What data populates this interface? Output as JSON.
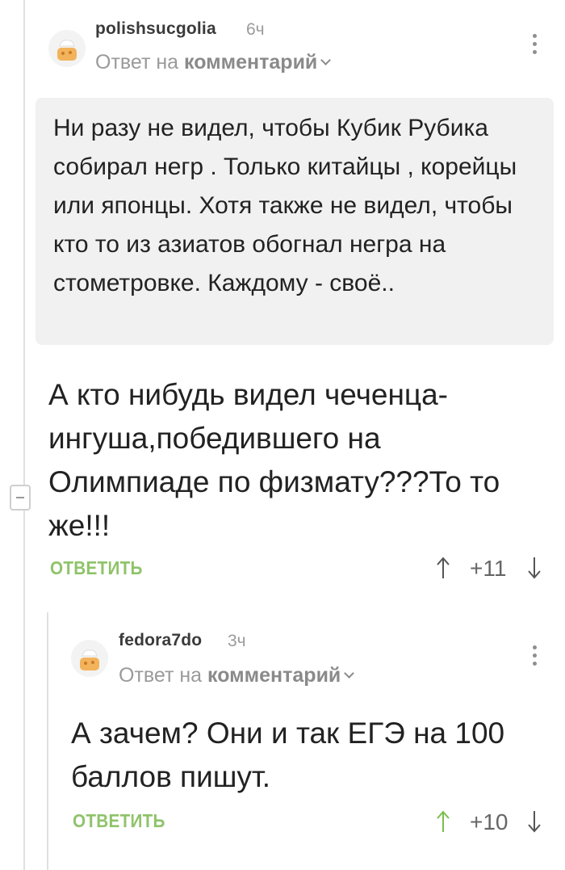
{
  "comment1": {
    "username": "polishsucgolia",
    "time": "6ч",
    "reply_prefix": "Ответ на",
    "reply_target": "комментарий",
    "quote": "Ни разу не видел, чтобы Кубик Рубика собирал негр . Только китайцы , корейцы или японцы. Хотя также не видел, чтобы кто то из азиатов обогнал негра на стометровке. Каждому - своё..",
    "text": "А кто нибудь видел чеченца-ингуша,победившего на Олимпиаде по физмату???То то же!!!",
    "reply_label": "ОТВЕТИТЬ",
    "score": "+11"
  },
  "comment2": {
    "username": "fedora7do",
    "time": "3ч",
    "reply_prefix": "Ответ на",
    "reply_target": "комментарий",
    "text": "А зачем? Они и так ЕГЭ на 100 баллов пишут.",
    "reply_label": "ОТВЕТИТЬ",
    "score": "+10"
  },
  "colors": {
    "accent_green": "#8fc36a",
    "upvoted_green": "#7bbf4d",
    "muted_gray": "#9a9a9a"
  },
  "icons": [
    "avatar-placeholder-icon",
    "chevron-down-icon",
    "more-vertical-icon",
    "arrow-up-icon",
    "arrow-down-icon",
    "collapse-icon"
  ]
}
